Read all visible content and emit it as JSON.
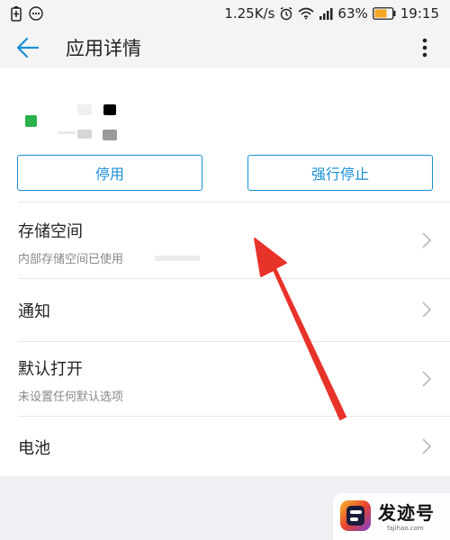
{
  "status_bar": {
    "network_speed": "1.25K/s",
    "battery_percent": "63%",
    "time": "19:15"
  },
  "app_bar": {
    "title": "应用详情"
  },
  "buttons": {
    "disable_label": "停用",
    "force_stop_label": "强行停止"
  },
  "list": [
    {
      "title": "存储空间",
      "subtitle": "内部存储空间已使用"
    },
    {
      "title": "通知"
    },
    {
      "title": "默认打开",
      "subtitle": "未设置任何默认选项"
    },
    {
      "title": "电池"
    }
  ],
  "watermark": {
    "brand": "发迹号",
    "url": "fajihao.com"
  },
  "colors": {
    "accent": "#1a8fd6",
    "annotation": "#e8332b",
    "battery": "#f5a623"
  }
}
